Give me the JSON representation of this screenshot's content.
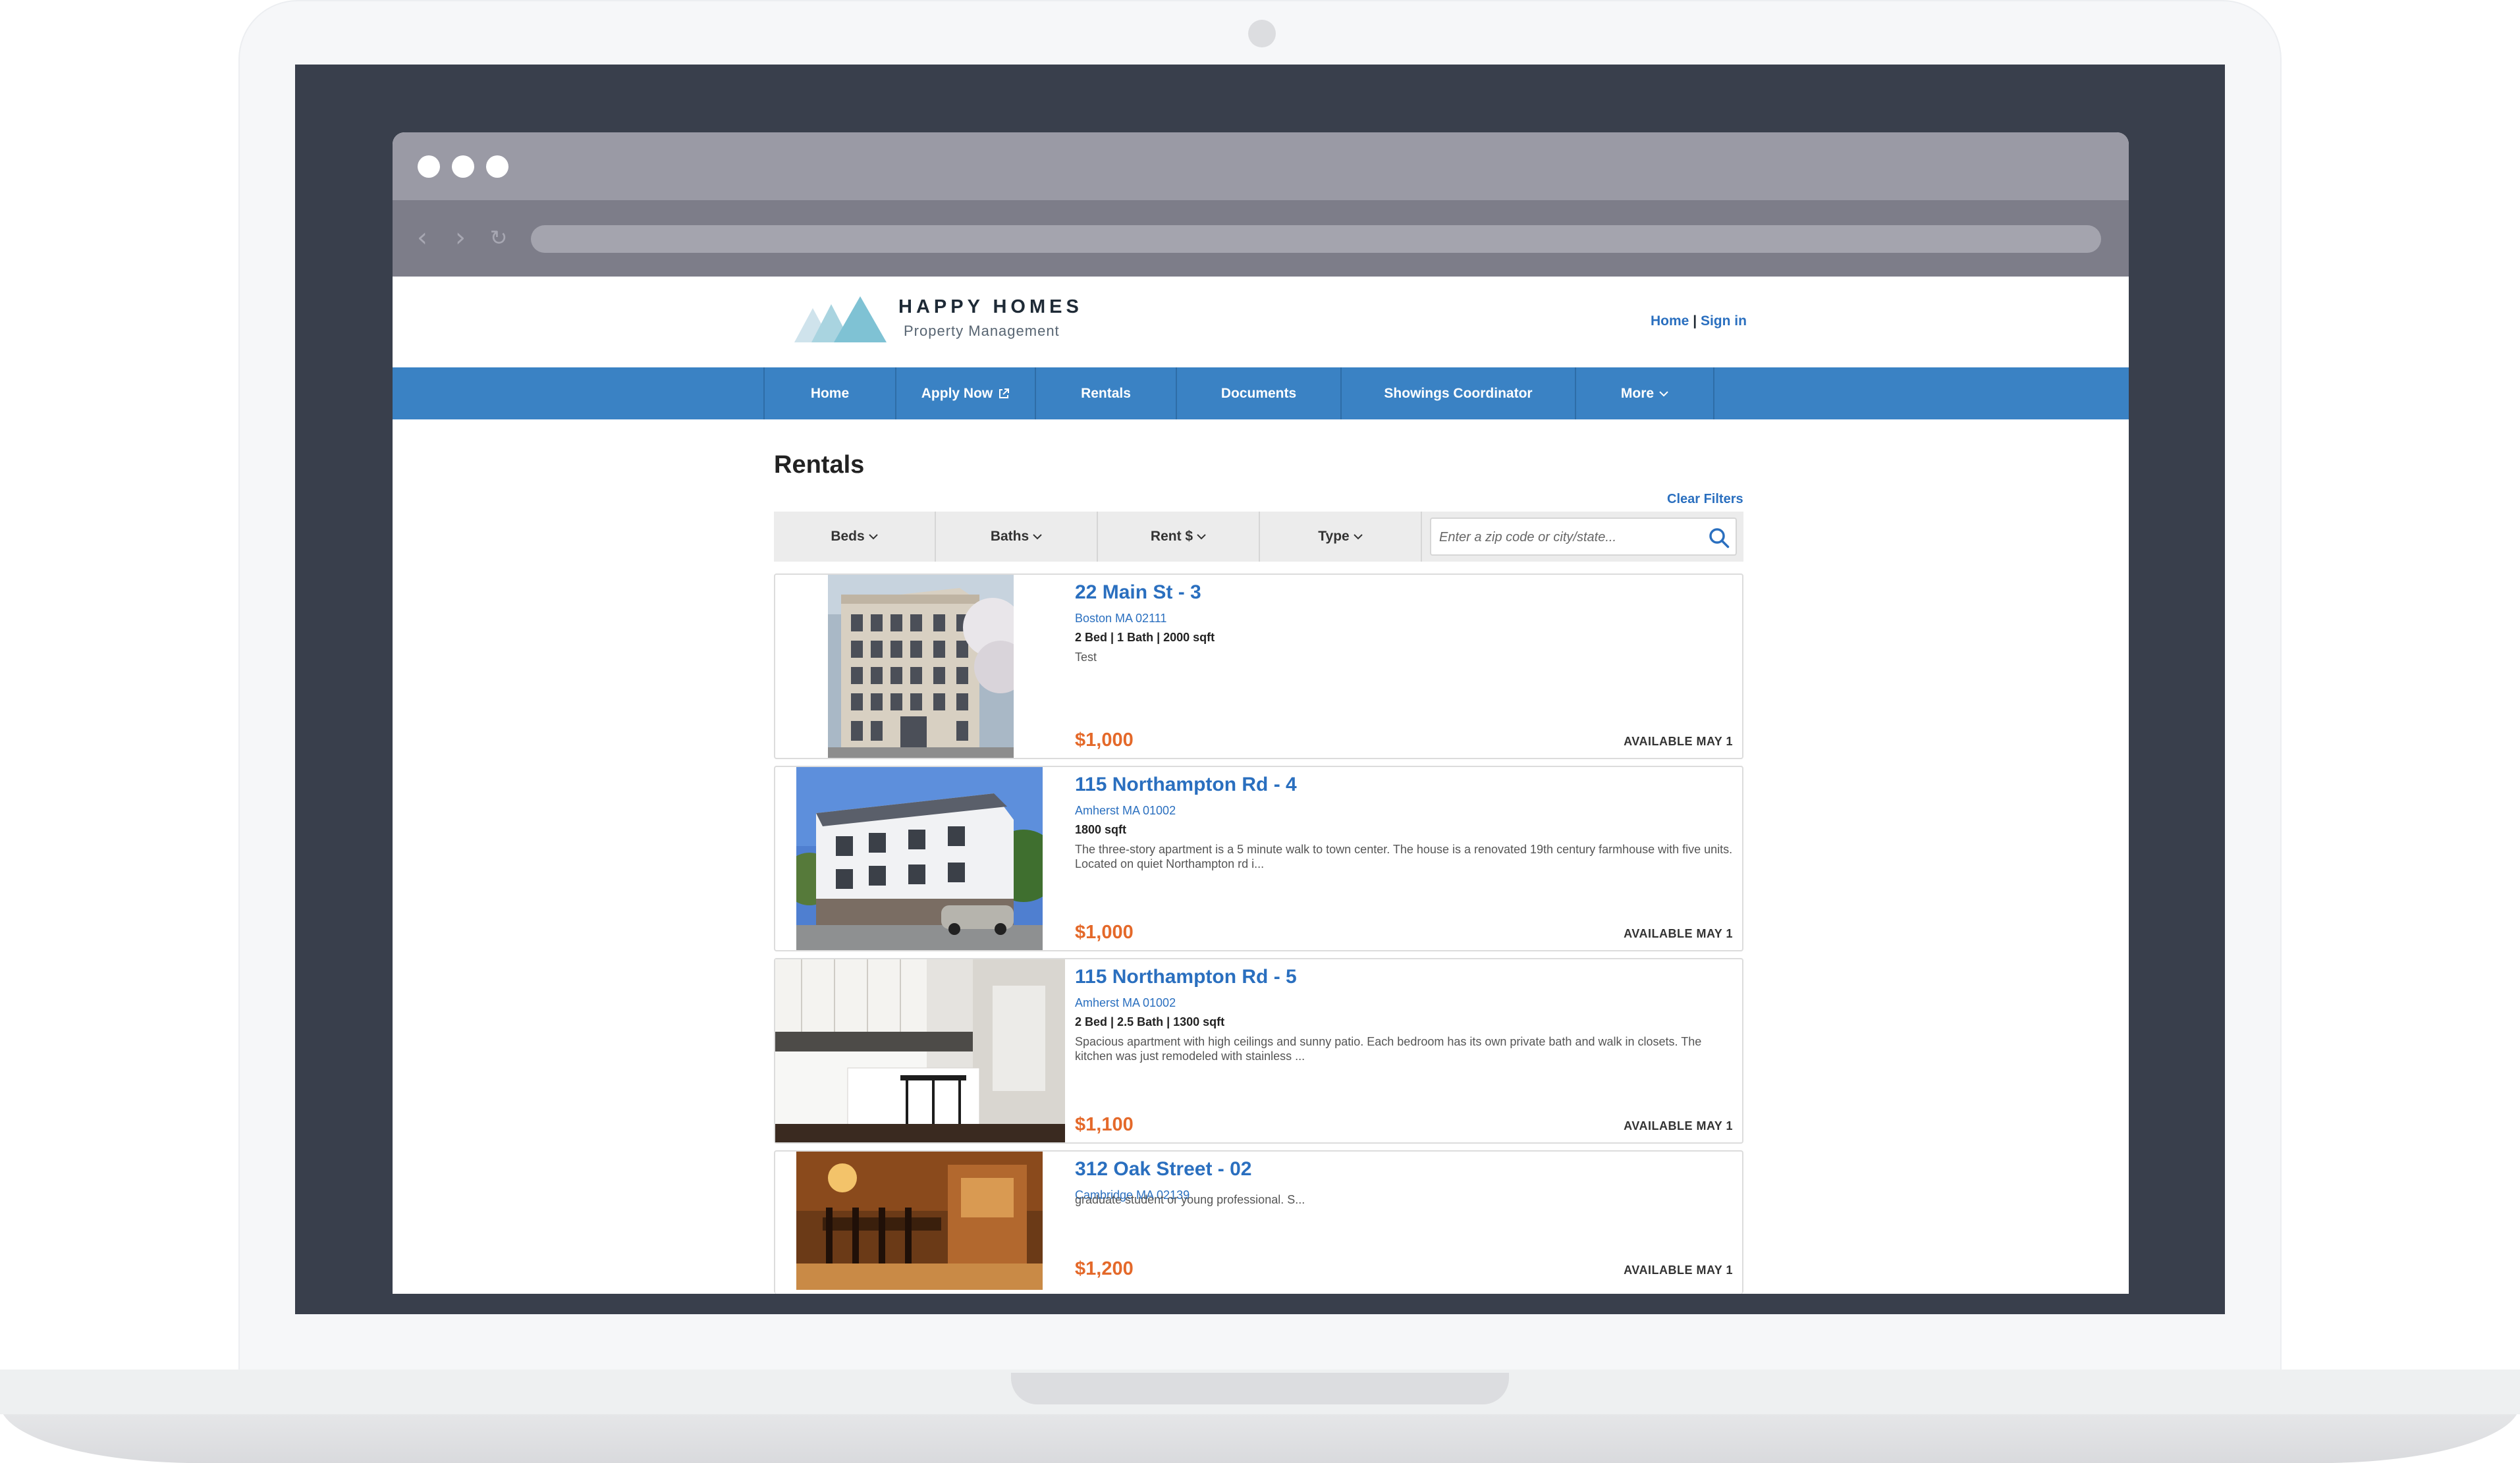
{
  "brand": {
    "name": "HAPPY HOMES",
    "tagline": "Property Management"
  },
  "toplinks": {
    "home": "Home",
    "separator": "|",
    "sign_in": "Sign in"
  },
  "nav": {
    "home": "Home",
    "apply_now": "Apply Now",
    "rentals": "Rentals",
    "documents": "Documents",
    "showings": "Showings Coordinator",
    "more": "More"
  },
  "page": {
    "title": "Rentals",
    "clear_filters": "Clear Filters"
  },
  "filters": {
    "beds": "Beds",
    "baths": "Baths",
    "rent": "Rent $",
    "type": "Type",
    "search_placeholder": "Enter a zip code or city/state..."
  },
  "listings": [
    {
      "title": "22 Main St - 3",
      "city": "Boston MA 02111",
      "specs": "2 Bed | 1 Bath | 2000 sqft",
      "description": "Test",
      "price": "$1,000",
      "availability": "AVAILABLE MAY 1"
    },
    {
      "title": "115 Northampton Rd - 4",
      "city": "Amherst MA 01002",
      "specs": "1800 sqft",
      "description": "The three-story apartment is a 5 minute walk to town center. The house is a renovated 19th century farmhouse with five units. Located on quiet Northampton rd i...",
      "price": "$1,000",
      "availability": "AVAILABLE MAY 1"
    },
    {
      "title": "115 Northampton Rd - 5",
      "city": "Amherst MA 01002",
      "specs": "2 Bed | 2.5 Bath | 1300 sqft",
      "description": "Spacious apartment with high ceilings and sunny patio. Each bedroom has its own private bath and walk in closets. The kitchen was just remodeled with stainless ...",
      "price": "$1,100",
      "availability": "AVAILABLE MAY 1"
    },
    {
      "title": "312 Oak Street - 02",
      "city": "Cambridge MA 02139",
      "specs": "",
      "description": "graduate student or young professional. S...",
      "price": "$1,200",
      "availability": "AVAILABLE MAY 1"
    }
  ],
  "colors": {
    "nav_blue": "#3a82c4",
    "link_blue": "#2a6fbf",
    "price_orange": "#e4692a",
    "bezel": "#393f4c"
  }
}
